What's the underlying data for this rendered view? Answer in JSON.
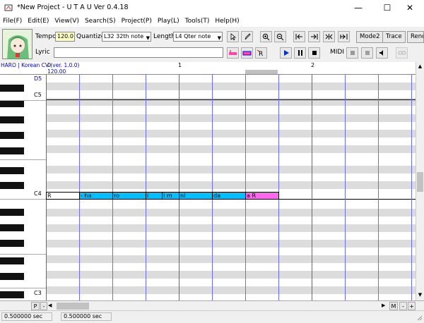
{
  "window": {
    "title": "*New Project - U T A U Ver 0.4.18",
    "minimize_glyph": "—",
    "maximize_glyph": "☐",
    "close_glyph": "✕"
  },
  "menu": [
    "File(F)",
    "Edit(E)",
    "View(V)",
    "Search(S)",
    "Project(P)",
    "Play(L)",
    "Tools(T)",
    "Help(H)"
  ],
  "toolbar": {
    "tempo_label": "Tempo",
    "tempo_value": "120.0",
    "quantize_label": "Quantize",
    "quantize_value": "L32 32th note",
    "length_label": "Length",
    "length_value": "L4 Qter note",
    "lyric_label": "Lyric",
    "lyric_value": "",
    "mode_button": "Mode2",
    "trace_button": "Trace",
    "render_button": "Rend",
    "midi_label": "MIDI"
  },
  "track_info": {
    "voicebank": "HARO | Korean CV (ver. 1.0.0)",
    "tempo_marker": "120.00"
  },
  "ruler": {
    "measures": [
      "0",
      "1",
      "2"
    ]
  },
  "keys": {
    "labels": [
      "D5",
      "C5",
      "C4",
      "C3"
    ]
  },
  "notes": [
    {
      "lyric": "R",
      "color": "#ffffff"
    },
    {
      "lyric": "- ha",
      "color": "#00bfff"
    },
    {
      "lyric": "ro",
      "color": "#00bfff"
    },
    {
      "lyric": "i",
      "color": "#00bfff"
    },
    {
      "lyric": "i m",
      "color": "#00bfff"
    },
    {
      "lyric": "nI",
      "color": "#00bfff"
    },
    {
      "lyric": "da",
      "color": "#00bfff"
    },
    {
      "lyric": "a R",
      "color": "#ff66ee"
    }
  ],
  "hscroll": {
    "p_button": "P",
    "minus_button": "-",
    "plus_button": "+",
    "m_button": "M"
  },
  "status": {
    "time1": "0.500000 sec",
    "time2": "0.500000 sec"
  }
}
